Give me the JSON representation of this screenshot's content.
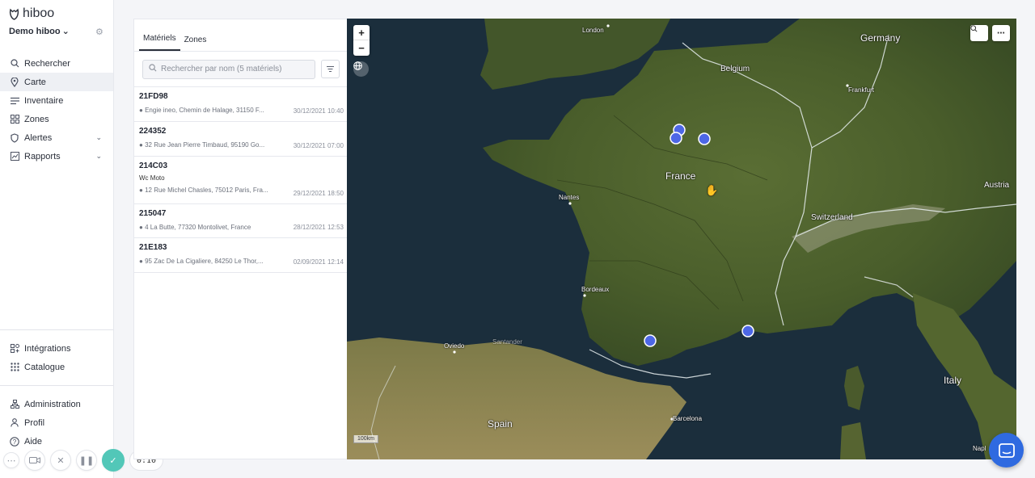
{
  "brand": {
    "name": "hiboo",
    "org": "Demo hiboo"
  },
  "nav": {
    "primary": [
      {
        "label": "Rechercher",
        "icon": "search-icon"
      },
      {
        "label": "Carte",
        "icon": "map-pin-icon"
      },
      {
        "label": "Inventaire",
        "icon": "list-icon"
      },
      {
        "label": "Zones",
        "icon": "grid-icon"
      },
      {
        "label": "Alertes",
        "icon": "shield-icon"
      },
      {
        "label": "Rapports",
        "icon": "chart-icon"
      }
    ],
    "secondary": [
      {
        "label": "Intégrations",
        "icon": "integrations-icon"
      },
      {
        "label": "Catalogue",
        "icon": "catalog-icon"
      }
    ],
    "tertiary": [
      {
        "label": "Administration",
        "icon": "org-icon"
      },
      {
        "label": "Profil",
        "icon": "user-icon"
      },
      {
        "label": "Aide",
        "icon": "help-icon"
      }
    ]
  },
  "recorder": {
    "time": "0:10"
  },
  "panel": {
    "tabs": [
      "Matériels",
      "Zones"
    ],
    "search_placeholder": "Rechercher par nom (5 matériels)",
    "assets": [
      {
        "name": "21FD98",
        "tags": "",
        "address": "Engie ineo, Chemin de Halage, 31150 F...",
        "date": "30/12/2021 10:40"
      },
      {
        "name": "224352",
        "tags": "",
        "address": "32 Rue Jean Pierre Timbaud, 95190 Go...",
        "date": "30/12/2021 07:00"
      },
      {
        "name": "214C03",
        "tags": "Wc  Moto",
        "address": "12 Rue Michel Chasles, 75012 Paris, Fra...",
        "date": "29/12/2021 18:50"
      },
      {
        "name": "215047",
        "tags": "",
        "address": "4 La Butte, 77320 Montolivet, France",
        "date": "28/12/2021 12:53"
      },
      {
        "name": "21E183",
        "tags": "",
        "address": "95 Zac De La Cigaliere, 84250 Le Thor,...",
        "date": "02/09/2021 12:14"
      }
    ]
  },
  "map": {
    "countries": [
      "Germany",
      "Belgium",
      "France",
      "Switzerland",
      "Austria",
      "Italy",
      "Spain"
    ],
    "cities": [
      "London",
      "Frankfurt",
      "Nantes",
      "Bordeaux",
      "Oviedo",
      "Santander",
      "Barcelona",
      "Napl"
    ],
    "scale": "100km",
    "marker_color": "#4d67e6",
    "zoom_in": "+",
    "zoom_out": "−"
  }
}
